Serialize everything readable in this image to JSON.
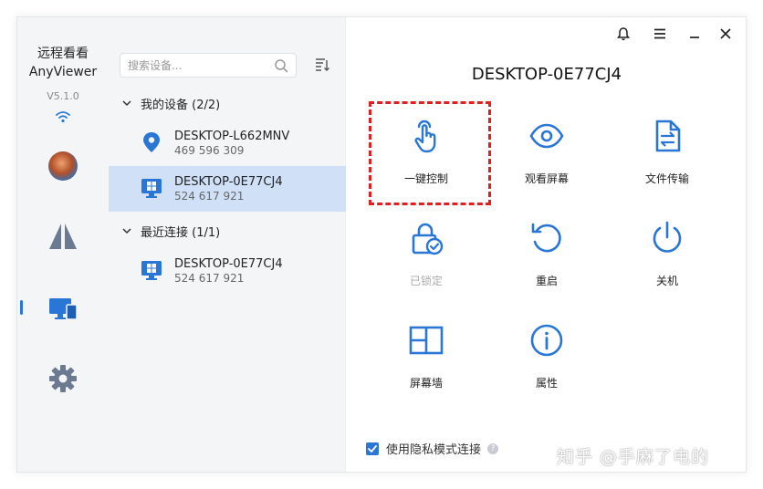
{
  "sidebar": {
    "app_name_cn": "远程看看",
    "app_name_en": "AnyViewer",
    "version": "V5.1.0"
  },
  "device_list": {
    "search_placeholder": "搜索设备...",
    "my_devices": {
      "label": "我的设备 (2/2)",
      "items": [
        {
          "name": "DESKTOP-L662MNV",
          "id": "469 596 309"
        },
        {
          "name": "DESKTOP-0E77CJ4",
          "id": "524 617 921"
        }
      ]
    },
    "recent": {
      "label": "最近连接 (1/1)",
      "items": [
        {
          "name": "DESKTOP-0E77CJ4",
          "id": "524 617 921"
        }
      ]
    }
  },
  "main": {
    "title": "DESKTOP-0E77CJ4",
    "actions": [
      {
        "label": "一键控制",
        "icon": "hand-pointer-icon"
      },
      {
        "label": "观看屏幕",
        "icon": "eye-icon"
      },
      {
        "label": "文件传输",
        "icon": "file-transfer-icon"
      },
      {
        "label": "已锁定",
        "icon": "lock-check-icon",
        "disabled": true
      },
      {
        "label": "重启",
        "icon": "restart-icon"
      },
      {
        "label": "关机",
        "icon": "power-icon"
      },
      {
        "label": "屏幕墙",
        "icon": "screen-wall-icon"
      },
      {
        "label": "属性",
        "icon": "info-icon"
      }
    ],
    "privacy_label": "使用隐私模式连接",
    "privacy_checked": true
  },
  "watermark": "知乎 @手麻了电的",
  "colors": {
    "accent": "#2a76d6",
    "selected_row": "#cfe0f7",
    "highlight_border": "#e02020",
    "sidebar_bg": "#f4f5f7"
  }
}
